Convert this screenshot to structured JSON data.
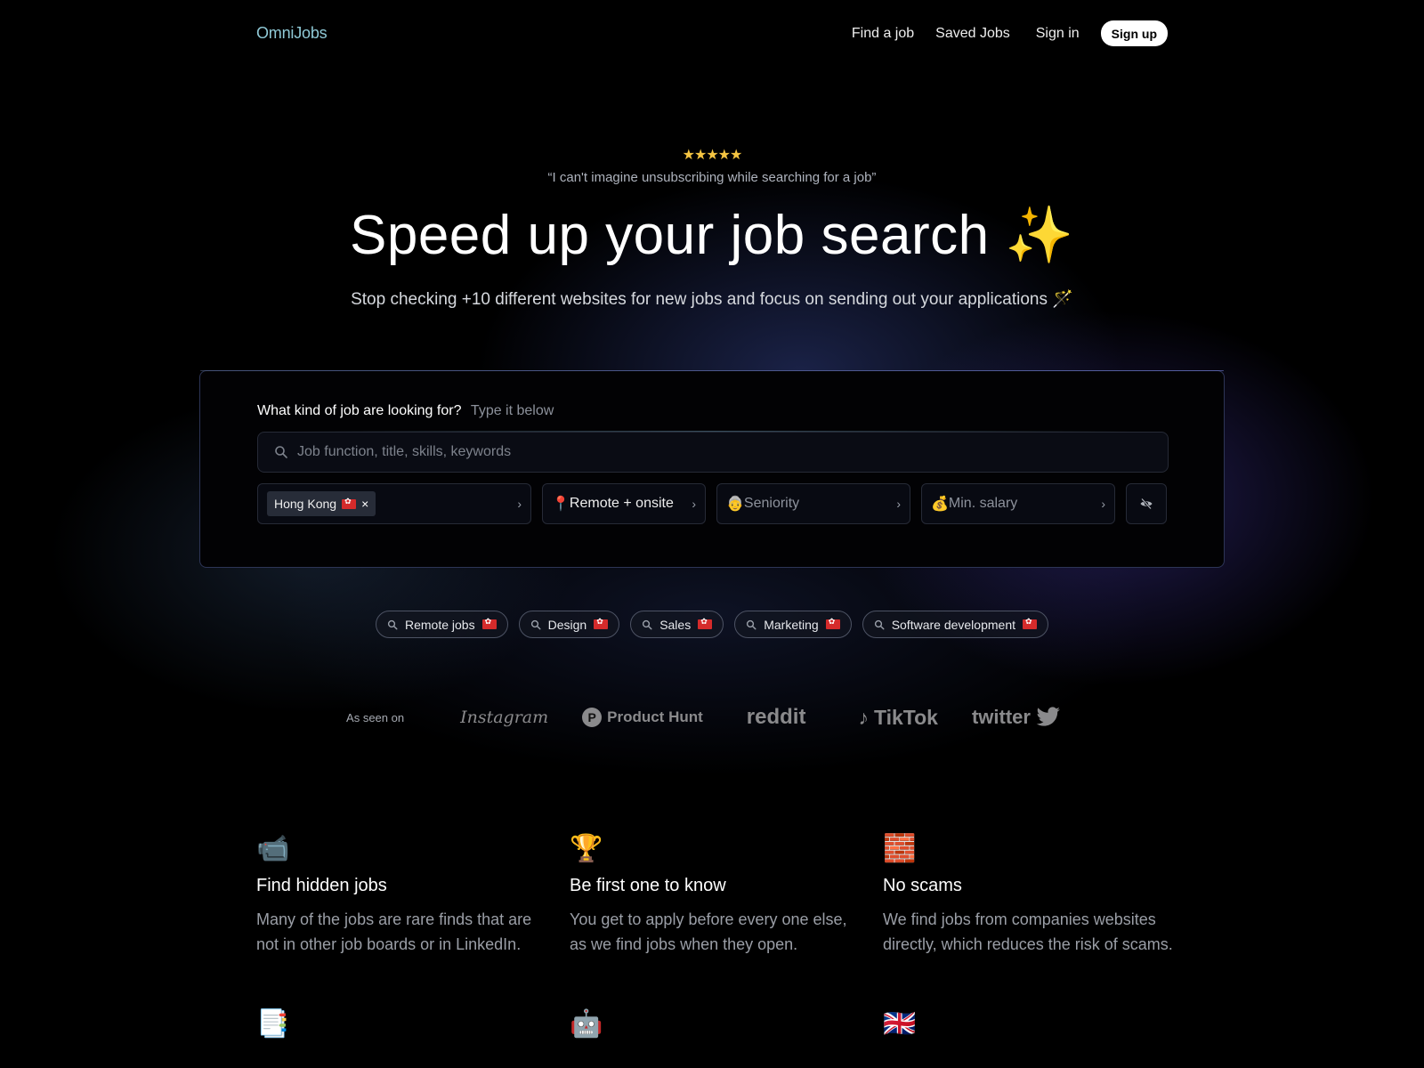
{
  "nav": {
    "logo": "OmniJobs",
    "links": [
      "Find a job",
      "Saved Jobs",
      "Sign in"
    ],
    "signup_label": "Sign up"
  },
  "hero": {
    "stars": "★★★★★",
    "rating": 5,
    "quote": "“I can't imagine unsubscribing while searching for a job”",
    "headline": "Speed up your job search",
    "headline_emoji": "✨",
    "subheadline": "Stop checking +10 different websites for new jobs and focus on sending out your applications 🪄"
  },
  "search": {
    "prompt": "What kind of job are looking for?",
    "hint": "Type it below",
    "placeholder": "Job function, title, skills, keywords",
    "value": "",
    "location_tag": "Hong Kong",
    "location_flag": "hk-flag",
    "remove_icon": "×",
    "work_type_emoji": "📍",
    "work_type": "Remote + onsite",
    "seniority_emoji": "👵",
    "seniority_placeholder": "Seniority",
    "salary_emoji": "💰",
    "salary_placeholder": "Min. salary",
    "chevron": "›",
    "hide_icon": "eye-off-icon"
  },
  "quick_searches": [
    {
      "label": "Remote jobs"
    },
    {
      "label": "Design"
    },
    {
      "label": "Sales"
    },
    {
      "label": "Marketing"
    },
    {
      "label": "Software development"
    }
  ],
  "as_seen_on": {
    "label": "As seen on",
    "brands": [
      "Instagram",
      "Product Hunt",
      "reddit",
      "TikTok",
      "twitter"
    ]
  },
  "features": [
    {
      "icon": "📹",
      "title": "Find hidden jobs",
      "text": "Many of the jobs are rare finds that are not in other job boards or in LinkedIn."
    },
    {
      "icon": "🏆",
      "title": "Be first one to know",
      "text": "You get to apply before every one else, as we find jobs when they open."
    },
    {
      "icon": "🧱",
      "title": "No scams",
      "text": "We find jobs from companies websites directly, which reduces the risk of scams."
    },
    {
      "icon": "📑",
      "title": "",
      "text": ""
    },
    {
      "icon": "🤖",
      "title": "",
      "text": ""
    },
    {
      "icon": "🇬🇧",
      "title": "",
      "text": ""
    }
  ]
}
